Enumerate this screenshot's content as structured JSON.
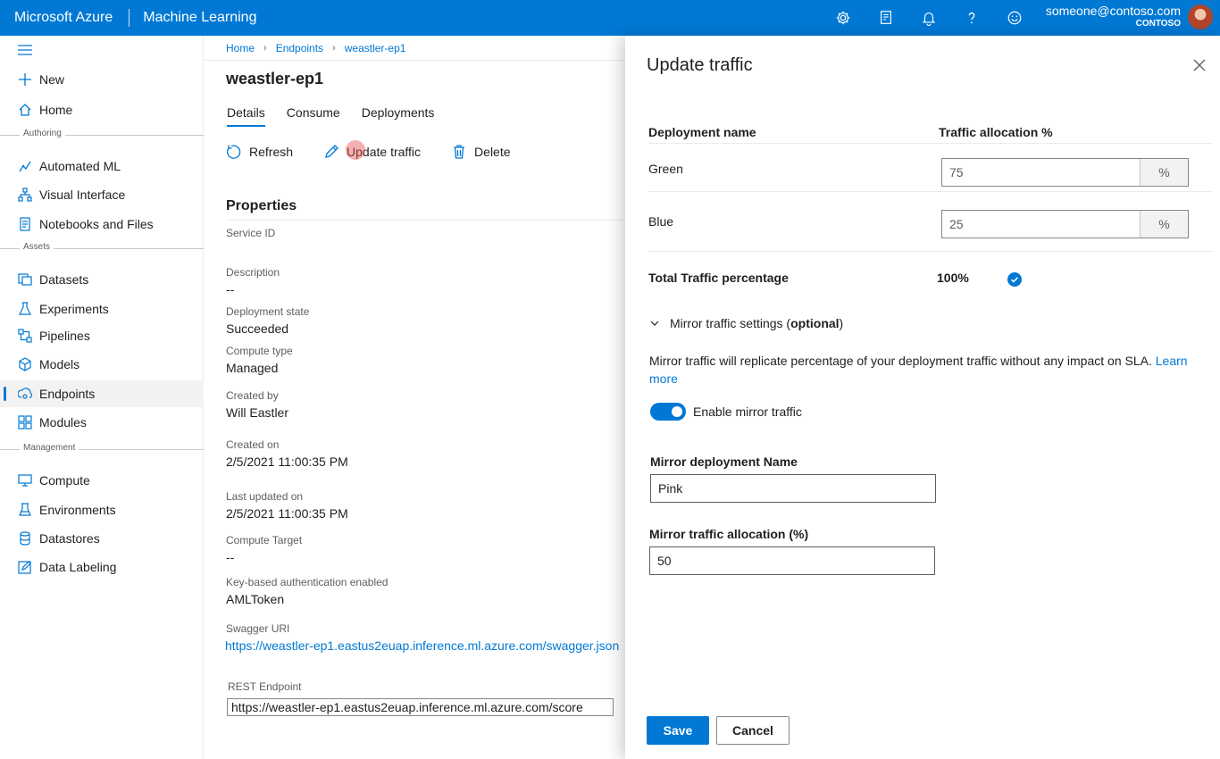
{
  "topbar": {
    "brand": "Microsoft Azure",
    "product": "Machine Learning",
    "icons": [
      "gear-icon",
      "feedback-icon",
      "bell-icon",
      "help-icon",
      "smiley-icon"
    ],
    "account_email": "someone@contoso.com",
    "account_org": "CONTOSO"
  },
  "sidebar": {
    "new_label": "New",
    "home_label": "Home",
    "section_authoring": "Authoring",
    "automated_ml": "Automated ML",
    "visual_interface": "Visual Interface",
    "notebooks": "Notebooks and Files",
    "section_assets": "Assets",
    "datasets": "Datasets",
    "experiments": "Experiments",
    "pipelines": "Pipelines",
    "models": "Models",
    "endpoints": "Endpoints",
    "modules": "Modules",
    "section_management": "Management",
    "compute": "Compute",
    "environments": "Environments",
    "datastores": "Datastores",
    "data_labeling": "Data Labeling",
    "active": "Endpoints"
  },
  "breadcrumb": {
    "home": "Home",
    "endpoints": "Endpoints",
    "current": "weastler-ep1"
  },
  "page": {
    "title": "weastler-ep1",
    "tabs": {
      "details": "Details",
      "consume": "Consume",
      "deployments": "Deployments"
    },
    "toolbar": {
      "refresh": "Refresh",
      "update_traffic": "Update traffic",
      "delete": "Delete"
    }
  },
  "properties": {
    "title": "Properties",
    "service_id_label": "Service ID",
    "description_label": "Description",
    "description_value": "--",
    "deployment_state_label": "Deployment state",
    "deployment_state_value": "Succeeded",
    "compute_type_label": "Compute type",
    "compute_type_value": "Managed",
    "created_by_label": "Created by",
    "created_by_value": "Will Eastler",
    "created_on_label": "Created on",
    "created_on_value": "2/5/2021 11:00:35 PM",
    "last_updated_label": "Last updated on",
    "last_updated_value": "2/5/2021 11:00:35 PM",
    "compute_target_label": "Compute Target",
    "compute_target_value": "--",
    "key_auth_label": "Key-based authentication enabled",
    "key_auth_value": "AMLToken",
    "swagger_label": "Swagger URI",
    "swagger_value": "https://weastler-ep1.eastus2euap.inference.ml.azure.com/swagger.json",
    "rest_label": "REST Endpoint",
    "rest_value": "https://weastler-ep1.eastus2euap.inference.ml.azure.com/score"
  },
  "panel": {
    "title": "Update traffic",
    "col_name": "Deployment name",
    "col_alloc": "Traffic allocation %",
    "rows": [
      {
        "name": "Green",
        "value": "75",
        "suffix": "%"
      },
      {
        "name": "Blue",
        "value": "25",
        "suffix": "%"
      }
    ],
    "total_label": "Total Traffic percentage",
    "total_value": "100%",
    "mirror_title": "Mirror traffic settings (",
    "mirror_optional": "optional",
    "mirror_close": ")",
    "mirror_desc": "Mirror traffic will replicate percentage of your deployment traffic without any impact on SLA. ",
    "mirror_learn": "Learn more",
    "enable_label": "Enable mirror traffic",
    "mirror_name_label": "Mirror deployment Name",
    "mirror_name_value": "Pink",
    "mirror_alloc_label": "Mirror traffic allocation (%)",
    "mirror_alloc_value": "50",
    "save": "Save",
    "cancel": "Cancel"
  }
}
